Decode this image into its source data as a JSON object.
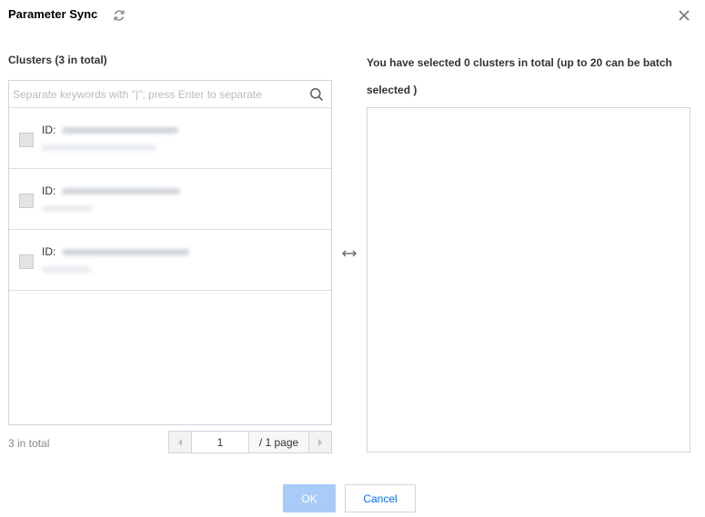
{
  "dialog": {
    "title": "Parameter Sync",
    "left_heading": "Clusters (3 in total)",
    "right_heading": "You have selected 0 clusters in total (up to 20 can be batch selected )"
  },
  "search": {
    "placeholder": "Separate keywords with \"|\"; press Enter to separate",
    "value": ""
  },
  "clusters": [
    {
      "id_label": "ID:",
      "checked": false
    },
    {
      "id_label": "ID:",
      "checked": false
    },
    {
      "id_label": "ID:",
      "checked": false
    }
  ],
  "pagination": {
    "total_text": "3 in total",
    "current_page": "1",
    "page_total_text": "/ 1 page"
  },
  "footer": {
    "ok_label": "OK",
    "cancel_label": "Cancel"
  },
  "colors": {
    "primary": "#006eff",
    "primary_disabled": "#a9cbf7",
    "border": "#cfd5de"
  }
}
